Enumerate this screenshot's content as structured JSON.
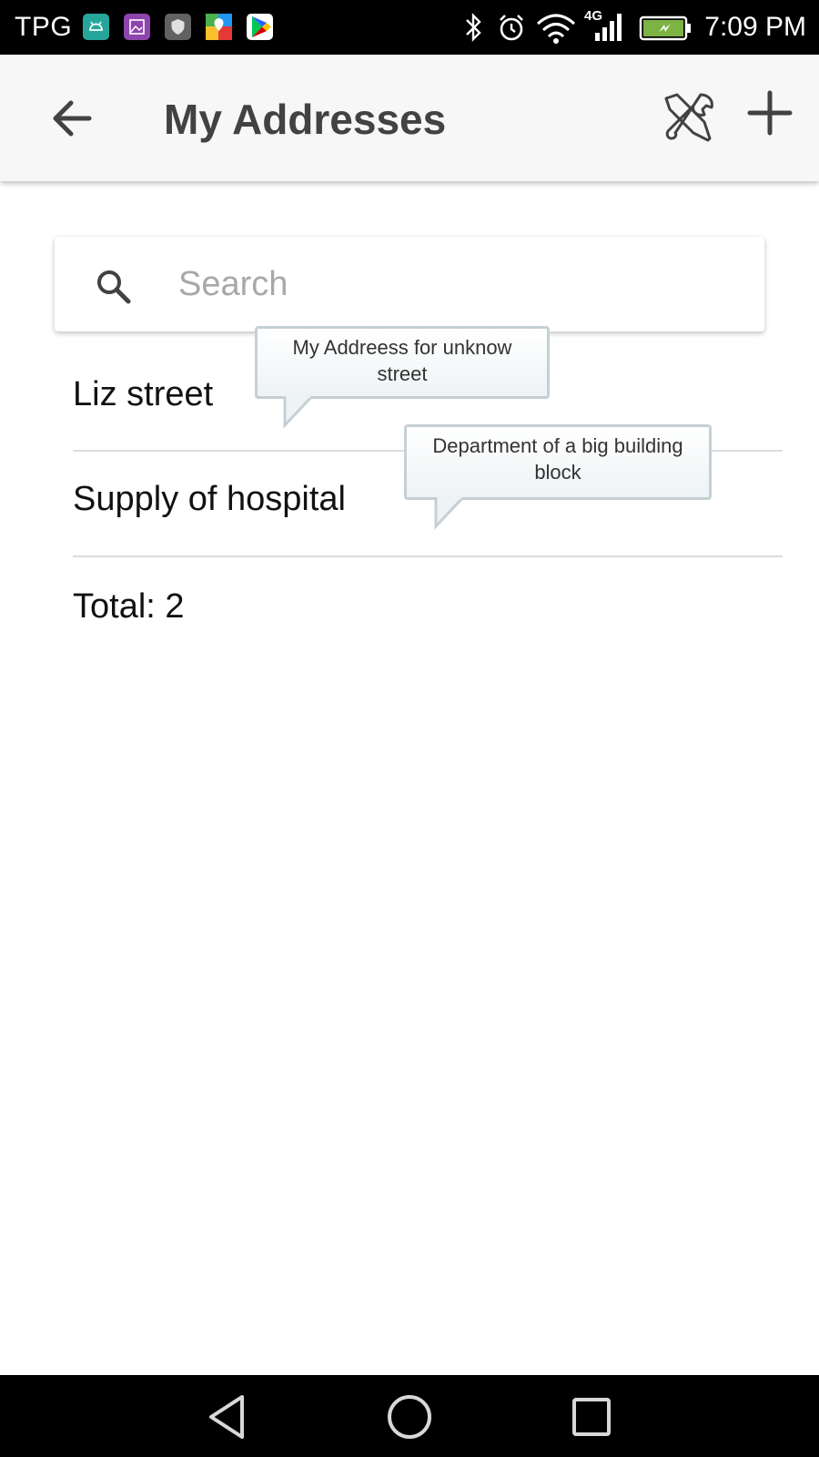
{
  "status_bar": {
    "carrier": "TPG",
    "network_type": "4G",
    "time": "7:09 PM",
    "notification_icons": [
      "android-icon",
      "gallery-icon",
      "shield-icon",
      "maps-icon",
      "play-store-icon"
    ],
    "battery_color": "#7cb342"
  },
  "app_bar": {
    "title": "My Addresses",
    "background": "#f7f7f7"
  },
  "search": {
    "placeholder": "Search",
    "value": ""
  },
  "addresses": [
    {
      "name": "Liz street",
      "tooltip": "My Addreess for unknow street"
    },
    {
      "name": "Supply of hospital",
      "tooltip": "Department of a big building block"
    }
  ],
  "footer": {
    "total_label": "Total: 2"
  }
}
